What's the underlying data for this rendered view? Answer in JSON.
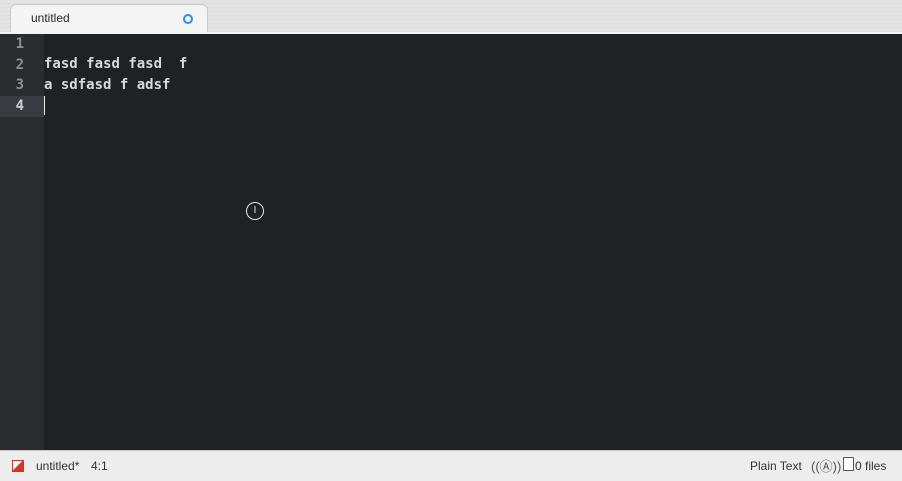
{
  "tab": {
    "title": "untitled"
  },
  "gutter": {
    "line_numbers": [
      "1",
      "2",
      "3",
      "4"
    ]
  },
  "editor": {
    "line2": {
      "words": [
        "fasd",
        " ",
        "fasd",
        " ",
        "fasd",
        "  f"
      ]
    },
    "line3": {
      "words": [
        "a ",
        "sdfasd",
        " f ",
        "adsf"
      ]
    }
  },
  "statusbar": {
    "file": "untitled*",
    "position": "4:1",
    "syntax": "Plain Text",
    "files": "0 files"
  },
  "colors": {
    "misspell_underline": "#e0483e",
    "dirty_dot": "#2f8fe6"
  }
}
